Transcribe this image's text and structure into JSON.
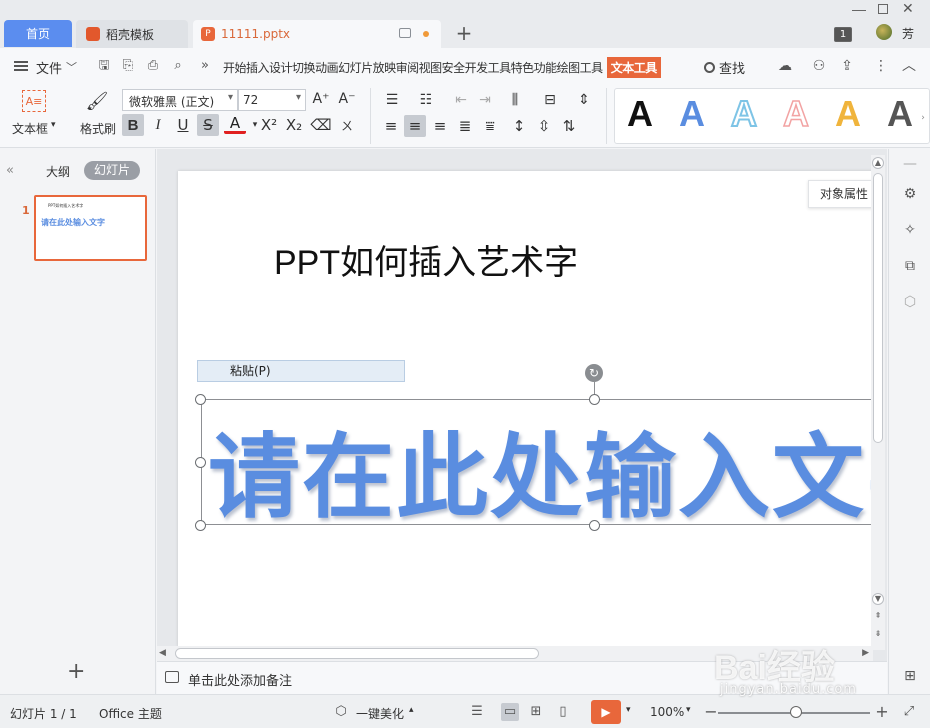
{
  "tabs": {
    "home": "首页",
    "template": "稻壳模板",
    "file": "11111.pptx"
  },
  "titlebar": {
    "window_count": "1",
    "username": "芳"
  },
  "menu": {
    "file": "文件",
    "items": [
      "开始",
      "插入",
      "设计",
      "切换",
      "动画",
      "幻灯片放映",
      "审阅",
      "视图",
      "安全",
      "开发工具",
      "特色功能",
      "绘图工具"
    ],
    "active": "文本工具",
    "search": "查找"
  },
  "ribbon": {
    "textbox_label": "文本框",
    "format_painter_label": "格式刷",
    "font_family": "微软雅黑 (正文)",
    "font_size": "72"
  },
  "colors": {
    "accent": "#e8673b",
    "home_tab": "#5b8def",
    "wordart_blue": "#5a8de0"
  },
  "wordart_styles": [
    {
      "glyph": "A",
      "color": "#111111"
    },
    {
      "glyph": "A",
      "color": "#5a8de0"
    },
    {
      "glyph": "A",
      "color": "#7ec4e6"
    },
    {
      "glyph": "A",
      "color": "#f2a3a3"
    },
    {
      "glyph": "A",
      "color": "#f0b43c"
    },
    {
      "glyph": "A",
      "color": "#555555"
    }
  ],
  "leftpanel": {
    "outline_tab": "大纲",
    "slides_tab": "幻灯片",
    "slide_number": "1",
    "thumb_title": "PPT如何插入艺术字",
    "thumb_art": "请在此处输入文字"
  },
  "slide": {
    "title": "PPT如何插入艺术字",
    "paste_label": "粘贴(P)",
    "art_text": "请在此处输入文字"
  },
  "tooltip": "对象属性",
  "notes_placeholder": "单击此处添加备注",
  "status": {
    "slide_counter": "幻灯片 1 / 1",
    "theme": "Office 主题",
    "beautify": "一键美化",
    "zoom": "100%"
  },
  "watermark": {
    "logo": "Bai经验",
    "url": "jingyan.baidu.com"
  }
}
